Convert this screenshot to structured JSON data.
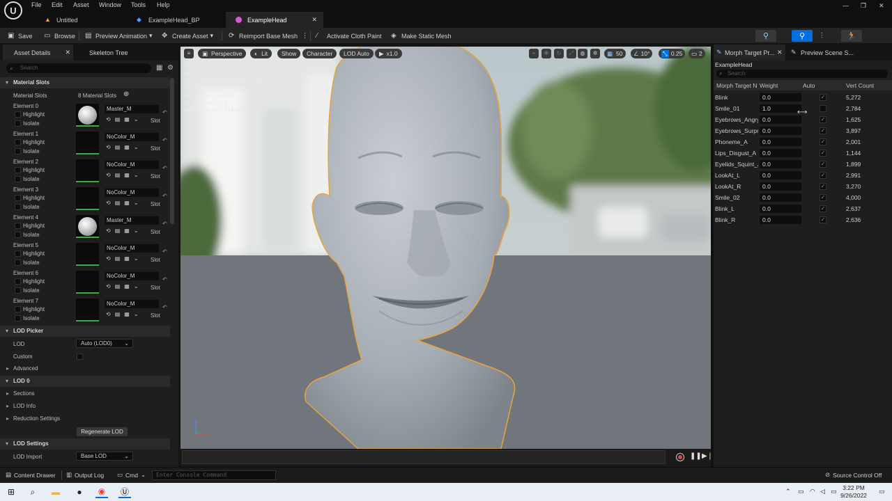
{
  "menu": {
    "items": [
      "File",
      "Edit",
      "Asset",
      "Window",
      "Tools",
      "Help"
    ]
  },
  "tabs": [
    {
      "label": "Untitled"
    },
    {
      "label": "ExampleHead_BP"
    },
    {
      "label": "ExampleHead"
    }
  ],
  "toolbar": {
    "save": "Save",
    "browse": "Browse",
    "preview_animation": "Preview Animation",
    "create_asset": "Create Asset",
    "reimport": "Reimport Base Mesh",
    "cloth_paint": "Activate Cloth Paint",
    "static_mesh": "Make Static Mesh"
  },
  "left_panel": {
    "tabs": [
      "Asset Details",
      "Skeleton Tree"
    ],
    "search_placeholder": "Search",
    "material_slots_section": "Material Slots",
    "material_slots_label": "Material Slots",
    "material_slots_count": "8 Material Slots",
    "highlight": "Highlight",
    "isolate": "Isolate",
    "slot": "Slot",
    "elements": [
      {
        "label": "Element 0",
        "material": "Master_M"
      },
      {
        "label": "Element 1",
        "material": "NoColor_M"
      },
      {
        "label": "Element 2",
        "material": "NoColor_M"
      },
      {
        "label": "Element 3",
        "material": "NoColor_M"
      },
      {
        "label": "Element 4",
        "material": "Master_M"
      },
      {
        "label": "Element 5",
        "material": "NoColor_M"
      },
      {
        "label": "Element 6",
        "material": "NoColor_M"
      },
      {
        "label": "Element 7",
        "material": "NoColor_M"
      }
    ],
    "lod_picker": "LOD Picker",
    "lod": "LOD",
    "lod_value": "Auto (LOD0)",
    "custom": "Custom",
    "advanced": "Advanced",
    "lod0": "LOD 0",
    "sections": "Sections",
    "lod_info": "LOD Info",
    "reduction": "Reduction Settings",
    "regenerate": "Regenerate LOD",
    "lod_settings": "LOD Settings",
    "lod_import": "LOD Import",
    "lod_import_value": "Base LOD"
  },
  "viewport": {
    "perspective": "Perspective",
    "lit": "Lit",
    "show": "Show",
    "character": "Character",
    "lod_auto": "LOD Auto",
    "speed": "x1.0",
    "grid": "50",
    "angle": "10°",
    "scale": "0.25",
    "cams": "2",
    "stats": [
      "Previewing Reference Pose",
      "LOD: 0",
      "Current Screen Size: 3.602",
      "Triangles: 19,072",
      "Vertices: 12,895",
      "UV Channels: 2",
      "Approx Size: 118x45x197"
    ]
  },
  "right_panel": {
    "tabs": [
      "Morph Target Pr...",
      "Preview Scene S..."
    ],
    "asset": "ExampleHead",
    "search_placeholder": "Search",
    "headers": {
      "name": "Morph Target N",
      "weight": "Weight",
      "auto": "Auto",
      "vert": "Vert Count"
    },
    "morphs": [
      {
        "name": "Blink",
        "weight": "0.0",
        "auto": true,
        "verts": "5,272"
      },
      {
        "name": "Smile_01",
        "weight": "1.0",
        "auto": false,
        "verts": "2,784"
      },
      {
        "name": "Eyebrows_Angry",
        "weight": "0.0",
        "auto": true,
        "verts": "1,625"
      },
      {
        "name": "Eyebrows_Surprise",
        "weight": "0.0",
        "auto": true,
        "verts": "3,897"
      },
      {
        "name": "Phoneme_A",
        "weight": "0.0",
        "auto": true,
        "verts": "2,001"
      },
      {
        "name": "Lips_Disgust_A",
        "weight": "0.0",
        "auto": true,
        "verts": "1,144"
      },
      {
        "name": "Eyelids_Squint_A",
        "weight": "0.0",
        "auto": true,
        "verts": "1,899"
      },
      {
        "name": "LookAt_L",
        "weight": "0.0",
        "auto": true,
        "verts": "2,991"
      },
      {
        "name": "LookAt_R",
        "weight": "0.0",
        "auto": true,
        "verts": "3,270"
      },
      {
        "name": "Smile_02",
        "weight": "0.0",
        "auto": true,
        "verts": "4,000"
      },
      {
        "name": "Blink_L",
        "weight": "0.0",
        "auto": true,
        "verts": "2,637"
      },
      {
        "name": "Blink_R",
        "weight": "0.0",
        "auto": true,
        "verts": "2,636"
      }
    ]
  },
  "statusbar": {
    "content_drawer": "Content Drawer",
    "output_log": "Output Log",
    "cmd": "Cmd",
    "console_placeholder": "Enter Console Command",
    "source_control": "Source Control Off"
  },
  "taskbar": {
    "time": "3:22 PM",
    "date": "9/26/2022"
  },
  "colors": {
    "accent": "#0070e0",
    "selection_outline": "#e8a33d",
    "checkbox": "#4a9eff"
  }
}
